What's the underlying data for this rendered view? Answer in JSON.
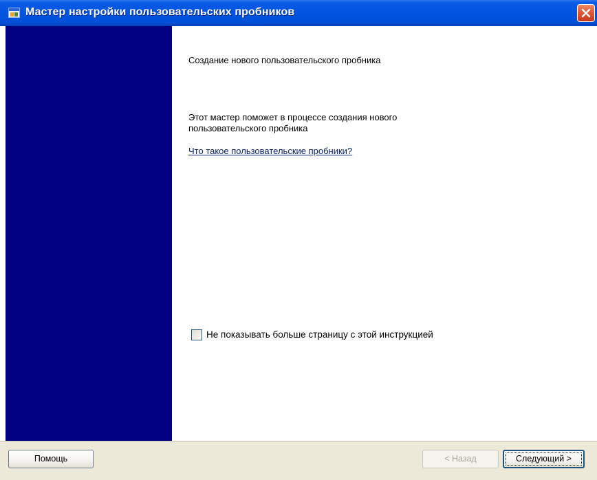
{
  "window": {
    "title": "Мастер настройки пользовательских пробников",
    "app_icon": "wizard-app-icon",
    "close_icon": "close-icon"
  },
  "content": {
    "heading": "Создание нового пользовательского пробника",
    "description": "Этот мастер поможет в процессе создания нового пользовательского пробника",
    "help_link": "Что такое пользовательские пробники?",
    "checkbox": {
      "label": "Не показывать больше страницу с этой инструкцией",
      "checked": false
    }
  },
  "buttons": {
    "help": "Помощь",
    "back": "< Назад",
    "back_enabled": false,
    "next": "Следующий >"
  },
  "colors": {
    "title_bar": "#0154e0",
    "side_panel": "#000080",
    "close_button": "#e05a3a",
    "link": "#0a246a",
    "button_bar": "#ece9d8"
  }
}
